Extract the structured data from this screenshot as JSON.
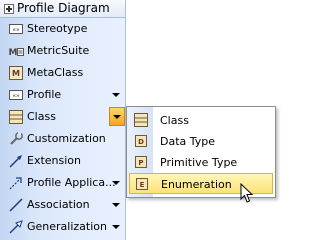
{
  "palette": {
    "header": {
      "title": "Profile Diagram"
    },
    "items": [
      {
        "label": "Stereotype",
        "icon": "stereotype-icon",
        "has_arrow": false
      },
      {
        "label": "MetricSuite",
        "icon": "metric-suite-icon",
        "has_arrow": false
      },
      {
        "label": "MetaClass",
        "icon": "metaclass-icon",
        "has_arrow": false
      },
      {
        "label": "Profile",
        "icon": "profile-icon",
        "has_arrow": true
      },
      {
        "label": "Class",
        "icon": "class-icon",
        "has_arrow": true,
        "active": true
      },
      {
        "label": "Customization",
        "icon": "customization-icon",
        "has_arrow": false
      },
      {
        "label": "Extension",
        "icon": "extension-icon",
        "has_arrow": false
      },
      {
        "label": "Profile Applica...",
        "icon": "profile-application-icon",
        "has_arrow": true
      },
      {
        "label": "Association",
        "icon": "association-icon",
        "has_arrow": true
      },
      {
        "label": "Generalization",
        "icon": "generalization-icon",
        "has_arrow": true
      }
    ]
  },
  "flyout": {
    "items": [
      {
        "label": "Class",
        "icon": "class-icon"
      },
      {
        "label": "Data Type",
        "icon": "data-type-icon"
      },
      {
        "label": "Primitive Type",
        "icon": "primitive-type-icon"
      },
      {
        "label": "Enumeration",
        "icon": "enumeration-icon",
        "hover": true
      }
    ]
  },
  "colors": {
    "palette_bg": "#dce8fb",
    "active_arrow": "#f5a623",
    "hover_highlight": "#fde27a"
  }
}
